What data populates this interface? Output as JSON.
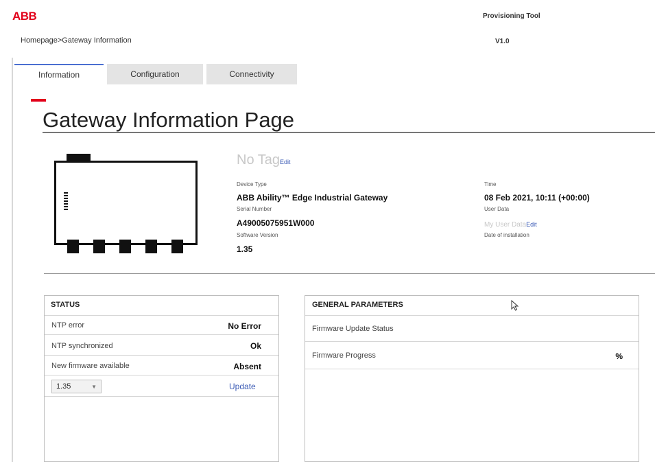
{
  "header": {
    "logo": "ABB",
    "app_title": "Provisioning Tool",
    "breadcrumb": "Homepage>Gateway Information",
    "version": "V1.0"
  },
  "tabs": [
    {
      "label": "Information",
      "active": true
    },
    {
      "label": "Configuration",
      "active": false
    },
    {
      "label": "Connectivity",
      "active": false
    }
  ],
  "page": {
    "title": "Gateway Information Page"
  },
  "device": {
    "tag": "No Tag",
    "tag_edit": "Edit",
    "device_type_label": "Device Type",
    "device_type": "ABB Ability™ Edge Industrial Gateway",
    "serial_label": "Serial Number",
    "serial": "A49005075951W000",
    "software_label": "Software Version",
    "software": "1.35",
    "time_label": "Time",
    "time": "08 Feb 2021, 10:11 (+00:00)",
    "user_data_label": "User Data",
    "user_data": "My User Data",
    "user_data_edit": "Edit",
    "install_label": "Date of installation"
  },
  "status": {
    "heading": "STATUS",
    "rows": [
      {
        "label": "NTP error",
        "value": "No Error"
      },
      {
        "label": "NTP synchronized",
        "value": "Ok"
      },
      {
        "label": "New firmware available",
        "value": "Absent"
      }
    ],
    "firmware_select": "1.35",
    "update_label": "Update"
  },
  "general": {
    "heading": "GENERAL PARAMETERS",
    "rows": [
      {
        "label": "Firmware Update Status",
        "value": ""
      },
      {
        "label": "Firmware Progress",
        "value": "%"
      }
    ]
  },
  "colors": {
    "brand_red": "#e2001a",
    "link_blue": "#3b5bb5",
    "active_tab": "#4a6fd1"
  },
  "icons": [
    "gateway-device-icon",
    "chevron-down-icon",
    "mouse-cursor-icon"
  ]
}
